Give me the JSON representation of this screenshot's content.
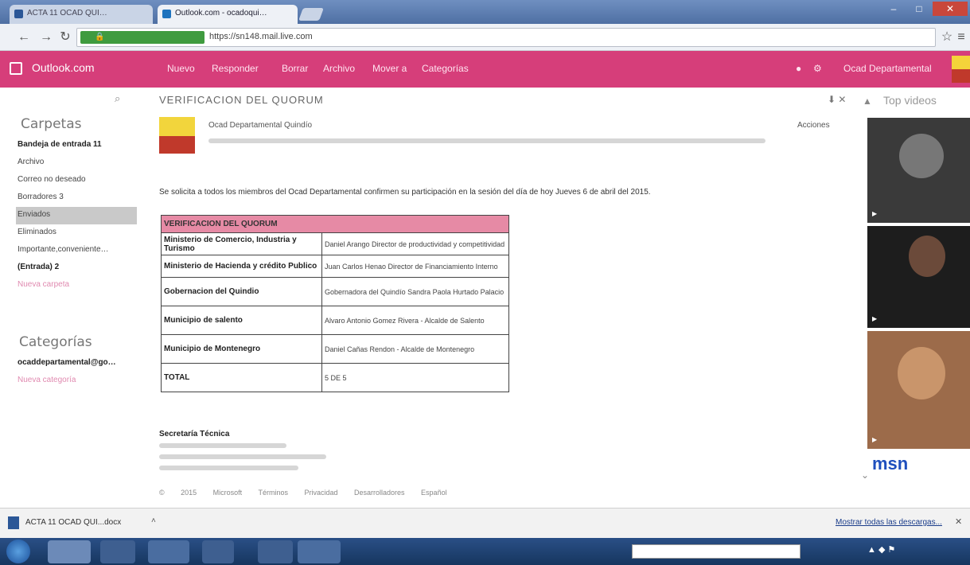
{
  "browser": {
    "tabs": [
      {
        "label": "ACTA 11 OCAD QUI…"
      },
      {
        "label": "Outlook.com - ocadoqui…"
      }
    ],
    "url": "https://sn148.mail.live.com"
  },
  "outlook": {
    "brand": "Outlook.com",
    "nav": [
      "Nuevo",
      "Responder",
      "Borrar",
      "Archivo",
      "Mover a",
      "Categorías"
    ],
    "user": "Ocad Departamental",
    "folders_title": "Carpetas",
    "folders": [
      {
        "label": "Bandeja de entrada  11",
        "style": "bold"
      },
      {
        "label": "Archivo",
        "style": ""
      },
      {
        "label": "Correo no deseado",
        "style": ""
      },
      {
        "label": "Borradores  3",
        "style": ""
      },
      {
        "label": "Enviados",
        "style": "sel"
      },
      {
        "label": "Eliminados",
        "style": ""
      },
      {
        "label": "Importante,conveniente…",
        "style": ""
      },
      {
        "label": "(Entrada)  2",
        "style": "bold"
      },
      {
        "label": "Nueva carpeta",
        "style": "pink"
      }
    ],
    "categories_title": "Categorías",
    "categories": [
      {
        "label": "ocaddepartamental@go…",
        "style": "bold"
      },
      {
        "label": "Nueva categoría",
        "style": "pink"
      }
    ]
  },
  "message": {
    "subject": "VERIFICACION DEL QUORUM",
    "sender": "Ocad Departamental Quindío",
    "actions": "Acciones",
    "body": "Se solicita a todos los miembros del Ocad Departamental confirmen su participación en la sesión del día de hoy Jueves 6 de abril del 2015.",
    "table": {
      "header": "VERIFICACION DEL QUORUM",
      "rows": [
        {
          "entity": "Ministerio de Comercio, Industria y Turismo",
          "rep": "Daniel Arango Director de productividad y competitividad"
        },
        {
          "entity": "Ministerio de Hacienda y crédito Publico",
          "rep": "Juan Carlos Henao Director de Financiamiento Interno"
        },
        {
          "entity": "Gobernacion del Quindio",
          "rep": "Gobernadora del Quindío Sandra Paola Hurtado Palacio"
        },
        {
          "entity": "Municipio de salento",
          "rep": "Alvaro Antonio Gomez Rivera - Alcalde de Salento"
        },
        {
          "entity": "Municipio de Montenegro",
          "rep": "Daniel Cañas Rendon - Alcalde de Montenegro"
        },
        {
          "entity": "TOTAL",
          "rep": "5 DE 5"
        }
      ]
    },
    "signature_title": "Secretaría Técnica"
  },
  "sidebar": {
    "title": "Top videos",
    "msn": "msn"
  },
  "footer": {
    "links": "© 2015 Microsoft Términos Privacidad Desarrolladores Español"
  },
  "downloads": {
    "file": "ACTA 11 OCAD QUI...docx",
    "show_all": "Mostrar todas las descargas..."
  },
  "colors": {
    "outlook_accent": "#d63e7a",
    "table_header": "#e68aa5"
  }
}
